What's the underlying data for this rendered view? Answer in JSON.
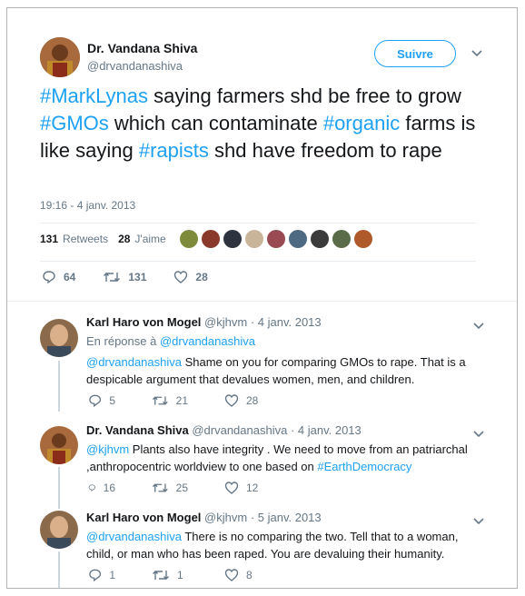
{
  "main_tweet": {
    "author_name": "Dr. Vandana Shiva",
    "author_handle": "@drvandanashiva",
    "follow_label": "Suivre",
    "text_parts": [
      {
        "t": "#MarkLynas",
        "link": true
      },
      {
        "t": " saying farmers shd be free to grow ",
        "link": false
      },
      {
        "t": "#GMOs",
        "link": true
      },
      {
        "t": " which can contaminate ",
        "link": false
      },
      {
        "t": "#organic",
        "link": true
      },
      {
        "t": " farms is like saying ",
        "link": false
      },
      {
        "t": "#rapists",
        "link": true
      },
      {
        "t": " shd have freedom to rape",
        "link": false
      }
    ],
    "timestamp": "19:16 - 4 janv. 2013",
    "retweets_count": "131",
    "retweets_label": "Retweets",
    "likes_count": "28",
    "likes_label": "J'aime",
    "replies": "64",
    "retweets": "131",
    "likes": "28"
  },
  "replies": [
    {
      "name": "Karl Haro von Mogel",
      "handle": "@kjhvm",
      "date": "· 4 janv. 2013",
      "in_reply_prefix": "En réponse à ",
      "in_reply_handle": "@drvandanashiva",
      "text_parts": [
        {
          "t": "@drvandanashiva",
          "link": true
        },
        {
          "t": " Shame on you for comparing GMOs to rape. That is a despicable argument that devalues women, men, and children.",
          "link": false
        }
      ],
      "replies": "5",
      "retweets": "21",
      "likes": "28"
    },
    {
      "name": "Dr. Vandana Shiva",
      "handle": "@drvandanashiva",
      "date": "· 4 janv. 2013",
      "text_parts": [
        {
          "t": "@kjhvm",
          "link": true
        },
        {
          "t": "  Plants also have integrity . We need to move from an patriarchal ,anthropocentric worldview to one based on ",
          "link": false
        },
        {
          "t": "#EarthDemocracy",
          "link": true
        }
      ],
      "replies": "16",
      "retweets": "25",
      "likes": "12"
    },
    {
      "name": "Karl Haro von Mogel",
      "handle": "@kjhvm",
      "date": "· 5 janv. 2013",
      "text_parts": [
        {
          "t": "@drvandanashiva",
          "link": true
        },
        {
          "t": " There is no comparing the two. Tell that to a woman, child, or man who has been raped. You are devaluing their humanity.",
          "link": false
        }
      ],
      "replies": "1",
      "retweets": "1",
      "likes": "8"
    }
  ],
  "colors": {
    "accent": "#1da1f2",
    "muted": "#657786",
    "text": "#14171a"
  }
}
